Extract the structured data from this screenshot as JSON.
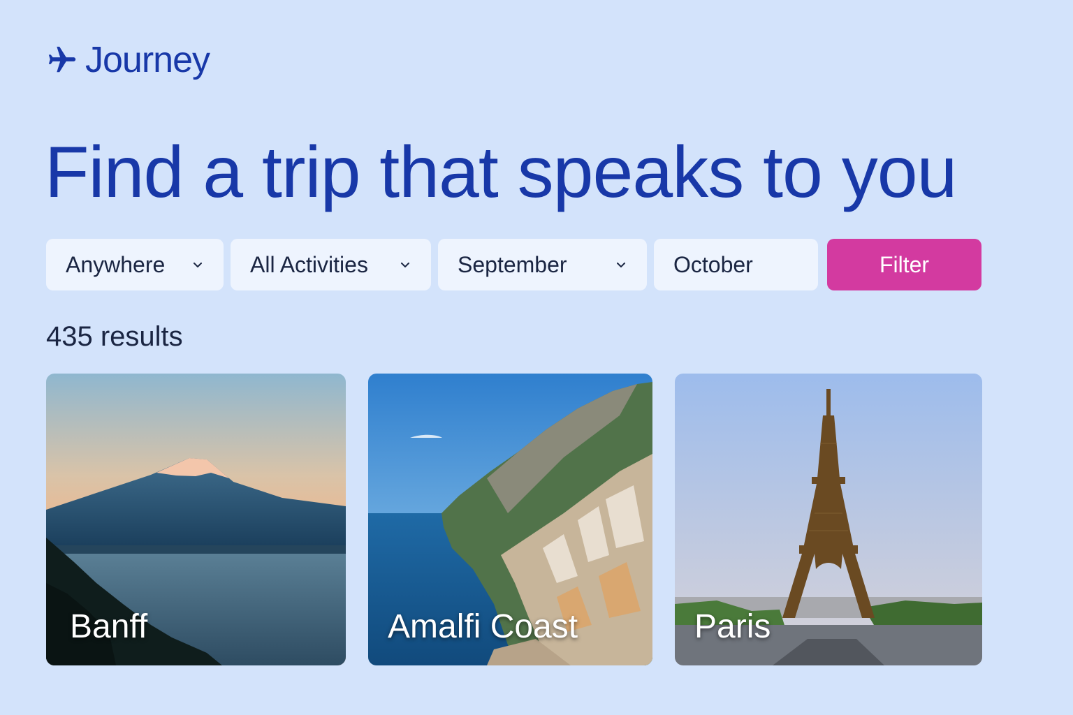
{
  "brand": {
    "name": "Journey",
    "icon": "airplane-icon",
    "color": "#1838a8"
  },
  "hero": {
    "headline": "Find a trip that speaks to you"
  },
  "filters": {
    "location": {
      "value": "Anywhere",
      "icon": "chevron-down-icon"
    },
    "activities": {
      "value": "All Activities",
      "icon": "chevron-down-icon"
    },
    "start_month": {
      "value": "September",
      "icon": "chevron-down-icon"
    },
    "end_month": {
      "value": "October"
    },
    "filter_button": {
      "label": "Filter",
      "color": "#d33aa0"
    }
  },
  "results": {
    "count_label": "435 results",
    "cards": [
      {
        "name": "Banff",
        "image": "mountain-lake-photo"
      },
      {
        "name": "Amalfi Coast",
        "image": "coastal-cliff-town-photo"
      },
      {
        "name": "Paris",
        "image": "eiffel-tower-photo"
      }
    ]
  },
  "colors": {
    "background": "#d3e3fb",
    "accent": "#1838a8",
    "field": "#eef4fe"
  }
}
